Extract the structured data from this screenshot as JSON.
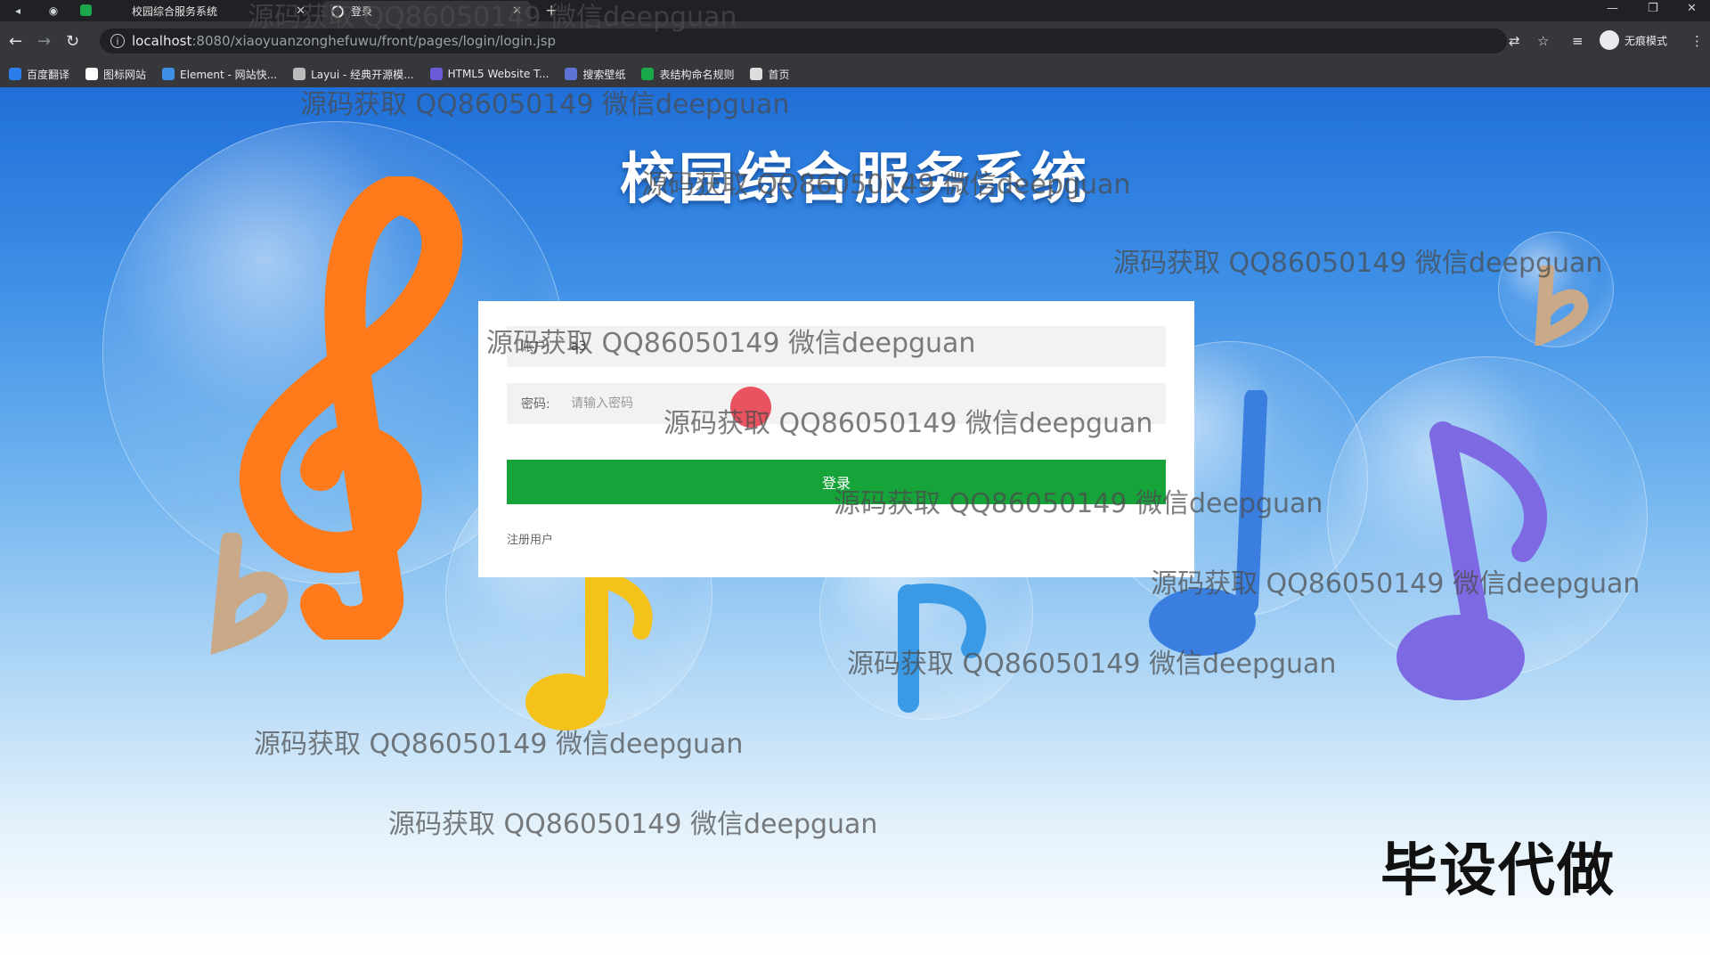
{
  "browser": {
    "tabs": [
      {
        "title": "校园综合服务系统",
        "active": false
      },
      {
        "title": "登录",
        "active": true
      }
    ],
    "url_host": "localhost",
    "url_path": ":8080/xiaoyuanzonghefuwu/front/pages/login/login.jsp",
    "incognito_label": "无痕模式",
    "bookmarks": [
      {
        "label": "百度翻译",
        "color": "#2b7de9"
      },
      {
        "label": "图标网站",
        "color": "#ffffff"
      },
      {
        "label": "Element - 网站快...",
        "color": "#3d8fe6"
      },
      {
        "label": "Layui - 经典开源模...",
        "color": "#bbbbbb"
      },
      {
        "label": "HTML5 Website T...",
        "color": "#6b5bd6"
      },
      {
        "label": "搜索壁纸",
        "color": "#5b74d6"
      },
      {
        "label": "表结构命名规则",
        "color": "#1aa84a"
      },
      {
        "label": "首页",
        "color": "#dddddd"
      }
    ]
  },
  "page": {
    "site_title": "校园综合服务系统",
    "login": {
      "account_label": "账户:",
      "account_value": "a3",
      "password_label": "密码:",
      "password_placeholder": "请输入密码",
      "login_button": "登录",
      "register_link": "注册用户"
    }
  },
  "overlay": {
    "watermark_text": "源码获取 QQ86050149 微信deepguan",
    "stamp_text": "毕设代做"
  },
  "colors": {
    "login_button": "#16a33a",
    "title": "#ffffff"
  }
}
